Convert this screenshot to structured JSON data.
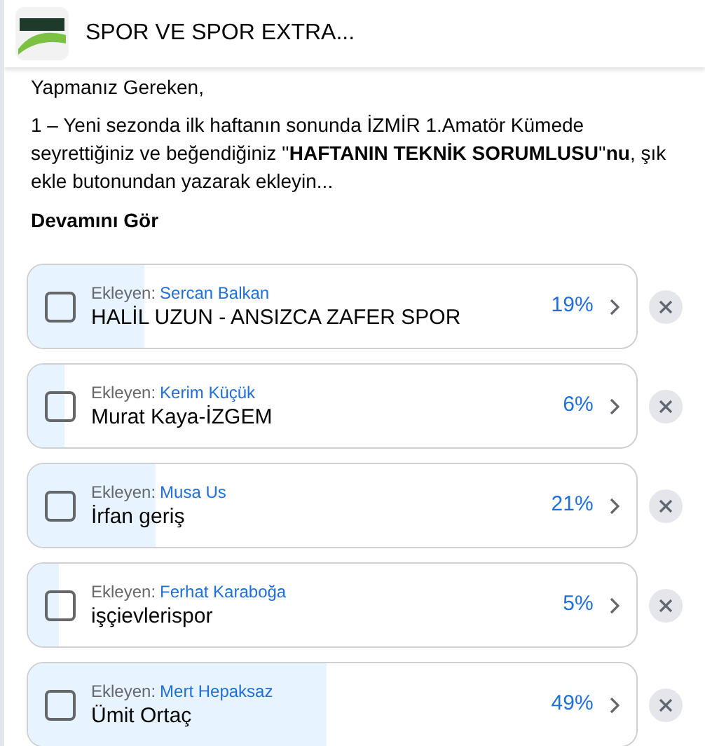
{
  "header": {
    "title": "SPOR VE SPOR EXTRA..."
  },
  "post": {
    "heading": "Yapmanız Gereken,",
    "body": "1 – Yeni sezonda ilk haftanın sonunda İZMİR 1.Amatör Kümede seyrettiğiniz ve beğendiğiniz ''**HAFTANIN TEKNİK SORUMLUSU**''**nu**, şık ekle butonundan yazarak ekleyin...",
    "more": "Devamını Gör"
  },
  "poll": {
    "options": [
      {
        "added_by_label": "Ekleyen:",
        "added_by": "Sercan Balkan",
        "text": "HALİL UZUN - ANSIZCA ZAFER SPOR",
        "percent": "19%",
        "level": 0.19,
        "checked": false
      },
      {
        "added_by_label": "Ekleyen:",
        "added_by": "Kerim Küçük",
        "text": "Murat Kaya-İZGEM",
        "percent": "6%",
        "level": 0.06,
        "checked": false
      },
      {
        "added_by_label": "Ekleyen:",
        "added_by": "Musa Us",
        "text": "İrfan geriş",
        "percent": "21%",
        "level": 0.21,
        "checked": false
      },
      {
        "added_by_label": "Ekleyen:",
        "added_by": "Ferhat Karaboğa",
        "text": "işçievlerispor",
        "percent": "5%",
        "level": 0.05,
        "checked": false
      },
      {
        "added_by_label": "Ekleyen:",
        "added_by": "Mert Hepaksaz",
        "text": "Ümit Ortaç",
        "percent": "49%",
        "level": 0.49,
        "checked": false
      }
    ]
  }
}
